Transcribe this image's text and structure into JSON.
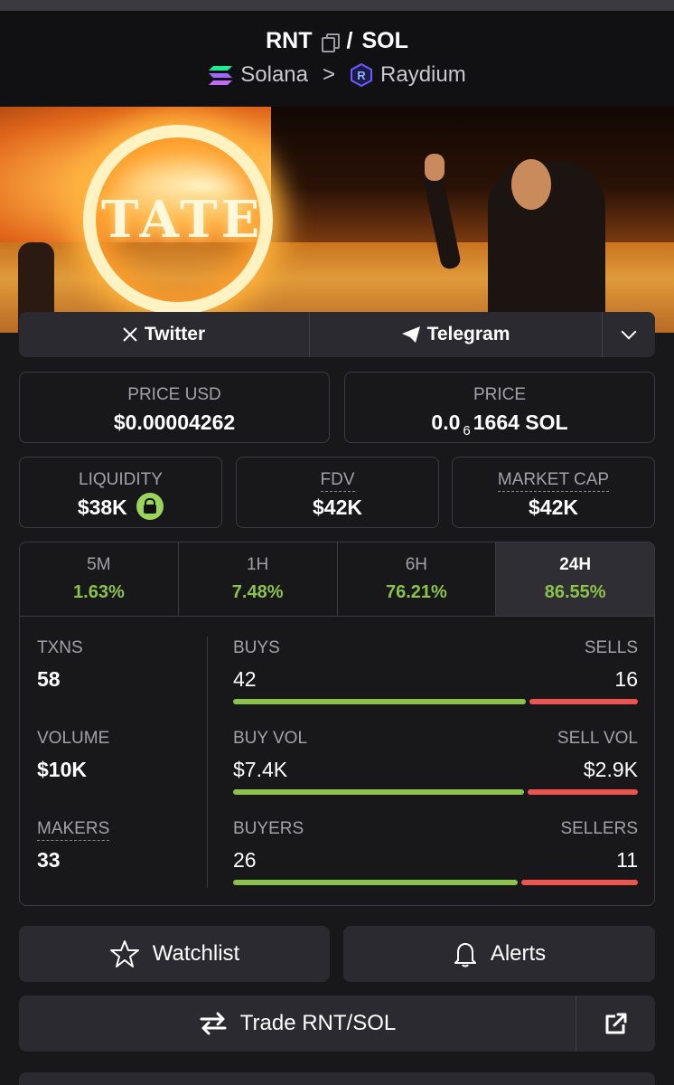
{
  "header": {
    "base_symbol": "RNT",
    "separator": "/",
    "quote_symbol": "SOL",
    "chain": "Solana",
    "chevron": ">",
    "dex": "Raydium"
  },
  "banner": {
    "text": "TATE"
  },
  "socials": {
    "twitter": "Twitter",
    "telegram": "Telegram"
  },
  "price": {
    "usd_label": "PRICE USD",
    "usd_value": "$0.00004262",
    "native_label": "PRICE",
    "native_prefix": "0.0",
    "native_zeros": "6",
    "native_digits": "1664 SOL"
  },
  "metrics": {
    "liquidity_label": "LIQUIDITY",
    "liquidity_value": "$38K",
    "fdv_label": "FDV",
    "fdv_value": "$42K",
    "mcap_label": "MARKET CAP",
    "mcap_value": "$42K"
  },
  "timeframes": [
    {
      "label": "5M",
      "change": "1.63%"
    },
    {
      "label": "1H",
      "change": "7.48%"
    },
    {
      "label": "6H",
      "change": "76.21%"
    },
    {
      "label": "24H",
      "change": "86.55%"
    }
  ],
  "stats": {
    "txns_label": "TXNS",
    "txns_value": "58",
    "volume_label": "VOLUME",
    "volume_value": "$10K",
    "makers_label": "MAKERS",
    "makers_value": "33",
    "buys_label": "BUYS",
    "buys_value": "42",
    "sells_label": "SELLS",
    "sells_value": "16",
    "buyvol_label": "BUY VOL",
    "buyvol_value": "$7.4K",
    "sellvol_label": "SELL VOL",
    "sellvol_value": "$2.9K",
    "buyers_label": "BUYERS",
    "buyers_value": "26",
    "sellers_label": "SELLERS",
    "sellers_value": "11",
    "buy_ratio_txns": 0.724,
    "buy_ratio_vol": 0.719,
    "buy_ratio_makers": 0.703
  },
  "actions": {
    "watchlist": "Watchlist",
    "alerts": "Alerts",
    "trade": "Trade RNT/SOL"
  },
  "colors": {
    "positive": "#8bc34a",
    "negative": "#ef5350",
    "background": "#18181b"
  }
}
